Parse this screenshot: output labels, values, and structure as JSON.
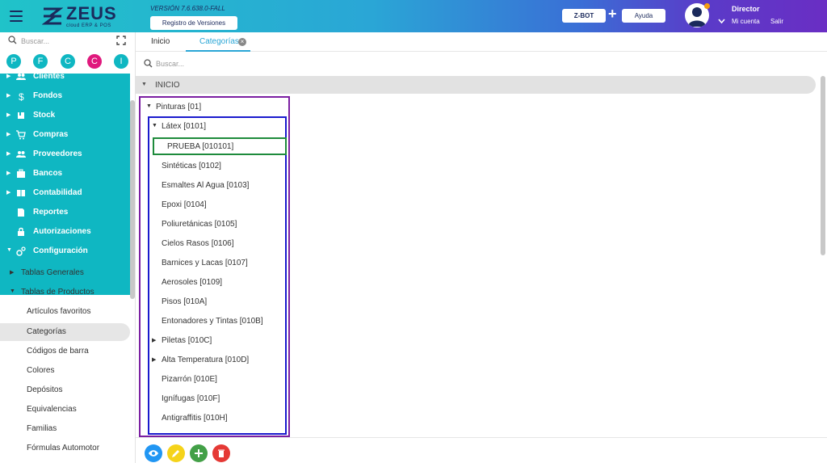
{
  "header": {
    "logo_text": "ZEUS",
    "logo_subtext": "cloud ERP & POS",
    "version": "VERSIÓN 7.6.638.0-FALL",
    "release_notes_button": "Registro de Versiones",
    "zbot_button": "Z-BOT",
    "plus": "+",
    "help_button": "Ayuda",
    "user_name": "Director",
    "my_account": "Mi cuenta",
    "logout": "Salir"
  },
  "sidebar": {
    "search_placeholder": "Buscar...",
    "quick_buttons": [
      {
        "letter": "P",
        "color": "#0fb7c2"
      },
      {
        "letter": "F",
        "color": "#0fb7c2"
      },
      {
        "letter": "C",
        "color": "#0fb7c2"
      },
      {
        "letter": "C",
        "color": "#e0197d"
      },
      {
        "letter": "I",
        "color": "#0fb7c2"
      }
    ],
    "modules": [
      {
        "label": "Clientes",
        "icon": "people-icon"
      },
      {
        "label": "Fondos",
        "icon": "dollar-icon"
      },
      {
        "label": "Stock",
        "icon": "box-icon"
      },
      {
        "label": "Compras",
        "icon": "cart-icon"
      },
      {
        "label": "Proveedores",
        "icon": "people-icon"
      },
      {
        "label": "Bancos",
        "icon": "briefcase-icon"
      },
      {
        "label": "Contabilidad",
        "icon": "book-icon"
      },
      {
        "label": "Reportes",
        "icon": "document-icon"
      },
      {
        "label": "Autorizaciones",
        "icon": "lock-icon"
      },
      {
        "label": "Configuración",
        "icon": "gears-icon"
      }
    ],
    "submenus": [
      "Tablas Generales",
      "Tablas de Productos"
    ],
    "leaves": [
      "Artículos favoritos",
      "Categorías",
      "Códigos de barra",
      "Colores",
      "Depósitos",
      "Equivalencias",
      "Familias",
      "Fórmulas Automotor"
    ],
    "active_leaf": "Categorías"
  },
  "tabs": [
    "Inicio",
    "Categorías"
  ],
  "main_search_placeholder": "Buscar...",
  "tree": {
    "root": "INICIO",
    "level1": "Pinturas [01]",
    "level2_open": "Látex [0101]",
    "level3": "PRUEBA [010101]",
    "siblings": [
      {
        "label": "Sintéticas [0102]",
        "expandable": false
      },
      {
        "label": "Esmaltes Al Agua [0103]",
        "expandable": false
      },
      {
        "label": "Epoxi [0104]",
        "expandable": false
      },
      {
        "label": "Poliuretánicas [0105]",
        "expandable": false
      },
      {
        "label": "Cielos Rasos [0106]",
        "expandable": false
      },
      {
        "label": "Barnices y Lacas [0107]",
        "expandable": false
      },
      {
        "label": "Aerosoles [0109]",
        "expandable": false
      },
      {
        "label": "Pisos [010A]",
        "expandable": false
      },
      {
        "label": "Entonadores y Tintas [010B]",
        "expandable": false
      },
      {
        "label": "Piletas [010C]",
        "expandable": true
      },
      {
        "label": "Alta Temperatura [010D]",
        "expandable": true
      },
      {
        "label": "Pizarrón [010E]",
        "expandable": false
      },
      {
        "label": "Ignífugas [010F]",
        "expandable": false
      },
      {
        "label": "Antigraffitis [010H]",
        "expandable": false
      }
    ]
  },
  "actions": [
    {
      "name": "view-button",
      "color": "#2196f3",
      "icon": "eye-icon"
    },
    {
      "name": "edit-button",
      "color": "#f5d31a",
      "icon": "pencil-icon"
    },
    {
      "name": "add-button",
      "color": "#43a047",
      "icon": "plus-icon"
    },
    {
      "name": "delete-button",
      "color": "#e53935",
      "icon": "trash-icon"
    }
  ]
}
